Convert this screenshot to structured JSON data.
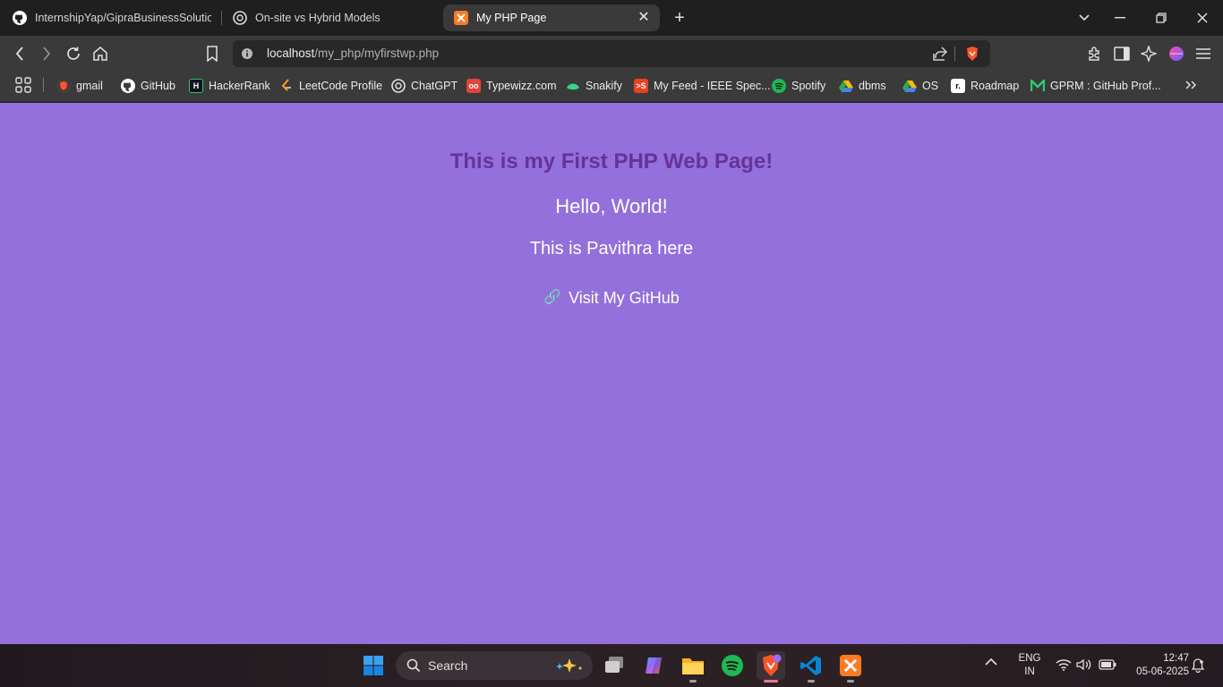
{
  "tabs": [
    {
      "label": "InternshipYap/GipraBusinessSolutions",
      "icon": "github-icon"
    },
    {
      "label": "On-site vs Hybrid Models",
      "icon": "chatgpt-icon"
    },
    {
      "label": "My PHP Page",
      "icon": "xampp-icon"
    }
  ],
  "new_tab_symbol": "+",
  "close_symbol": "✕",
  "address": {
    "host": "localhost",
    "path": "/my_php/myfirstwp.php"
  },
  "bookmarks": [
    {
      "label": "gmail",
      "icon": "brave-profile-icon",
      "color": "#f5f5f5"
    },
    {
      "label": "GitHub",
      "icon": "github-icon",
      "color": "#ffffff"
    },
    {
      "label": "HackerRank",
      "icon": "hackerrank-icon",
      "color": "#0e141e"
    },
    {
      "label": "LeetCode Profile",
      "icon": "leetcode-icon",
      "color": "#ffa116"
    },
    {
      "label": "ChatGPT",
      "icon": "chatgpt-icon",
      "color": "#ffffff"
    },
    {
      "label": "Typewizz.com",
      "icon": "typewizz-icon",
      "color": "#e0443a"
    },
    {
      "label": "Snakify",
      "icon": "snakify-icon",
      "color": "#3ccf8e"
    },
    {
      "label": "My Feed - IEEE Spec...",
      "icon": "ieee-spectrum-icon",
      "color": "#e8411e"
    },
    {
      "label": "Spotify",
      "icon": "spotify-icon",
      "color": "#1db954"
    },
    {
      "label": "dbms",
      "icon": "google-drive-icon",
      "color": "#34a853"
    },
    {
      "label": "OS",
      "icon": "google-drive-icon",
      "color": "#34a853"
    },
    {
      "label": "Roadmap",
      "icon": "roadmap-icon",
      "color": "#ffffff"
    },
    {
      "label": "GPRM : GitHub Prof...",
      "icon": "gprm-icon",
      "color": "#2ecc71"
    }
  ],
  "page": {
    "heading": "This is my First PHP Web Page!",
    "greeting": "Hello, World!",
    "intro": "This is Pavithra here",
    "link_icon": "🔗",
    "link_text": "Visit My GitHub",
    "background": "#9370db",
    "heading_color": "#663399"
  },
  "taskbar": {
    "search_label": "Search",
    "language": "ENG",
    "region": "IN",
    "time": "12:47",
    "date": "05-06-2025"
  }
}
